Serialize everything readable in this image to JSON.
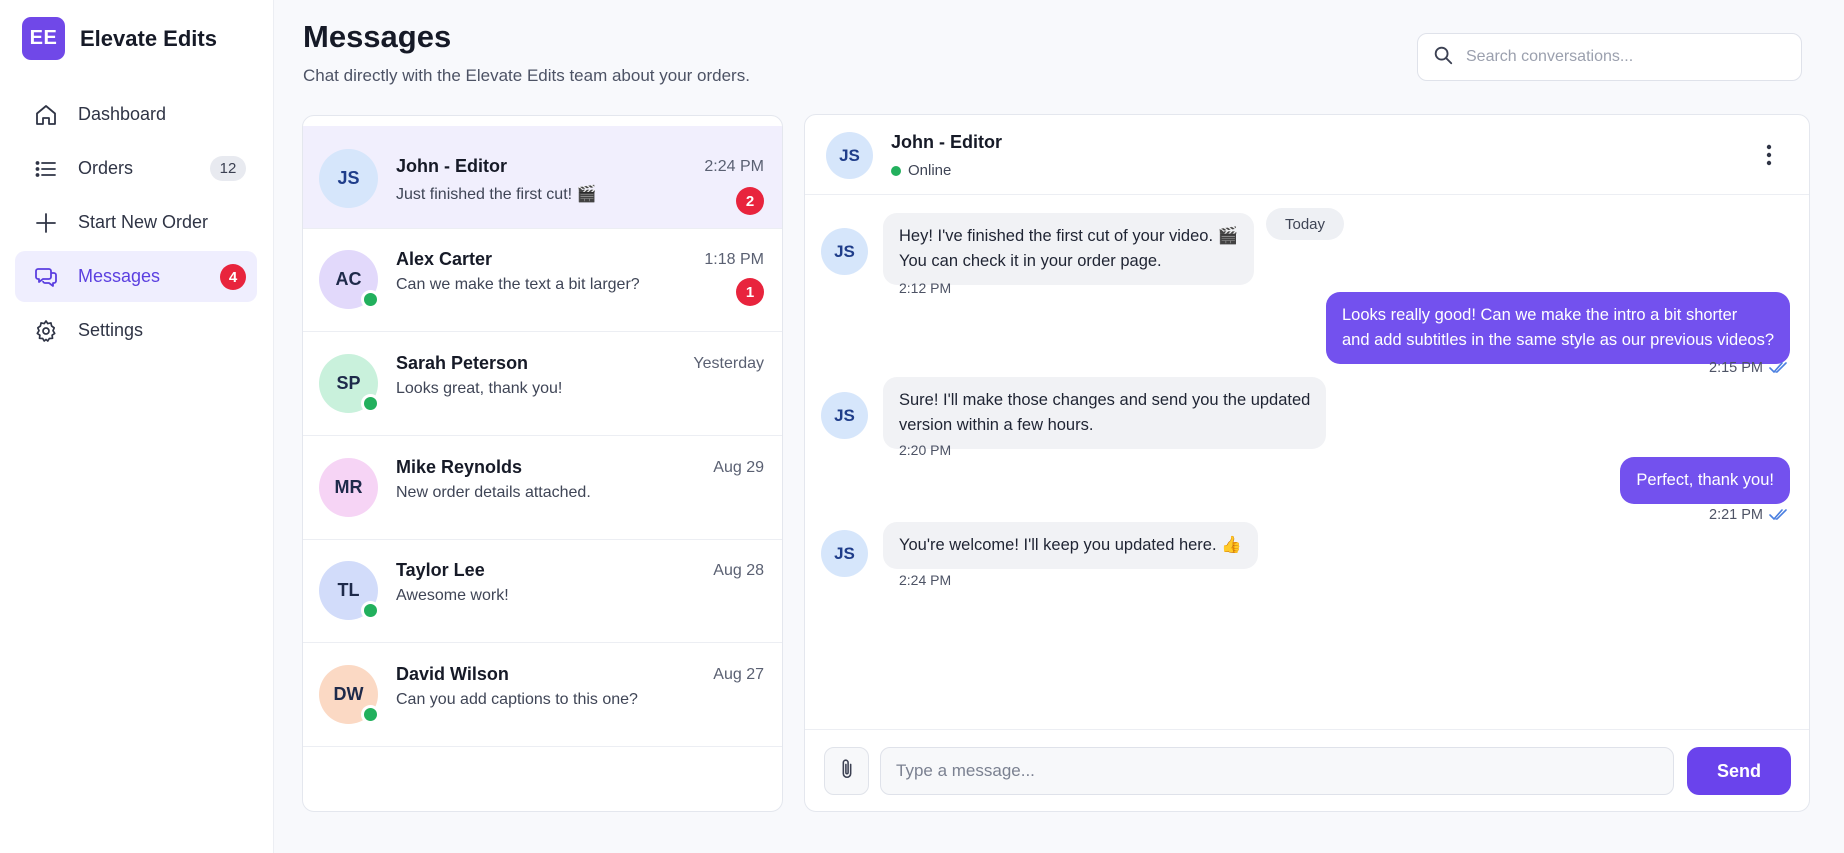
{
  "brand": {
    "logo_text": "EE",
    "name": "Elevate Edits",
    "accent": "#7048e8"
  },
  "nav": {
    "items": [
      {
        "label": "Dashboard",
        "icon": "home-icon"
      },
      {
        "label": "Orders",
        "icon": "list-icon",
        "count": "12"
      },
      {
        "label": "Start New Order",
        "icon": "plus-icon"
      },
      {
        "label": "Messages",
        "icon": "chat-icon",
        "badge": "4",
        "active": true
      },
      {
        "label": "Settings",
        "icon": "gear-icon"
      }
    ]
  },
  "header": {
    "title": "Messages",
    "subtitle": "Chat directly with the Elevate Edits team about your orders.",
    "search_placeholder": "Search conversations..."
  },
  "conversations": [
    {
      "initials": "JS",
      "name": "John - Editor",
      "time": "2:24 PM",
      "preview": "Just finished the first cut! 🎬",
      "unread": "2",
      "online": false,
      "active": true,
      "color": "#d6e6fb"
    },
    {
      "initials": "AC",
      "name": "Alex Carter",
      "time": "1:18 PM",
      "preview": "Can we make the text a bit larger?",
      "unread": "1",
      "online": true,
      "color": "#e2d9fb"
    },
    {
      "initials": "SP",
      "name": "Sarah Peterson",
      "time": "Yesterday",
      "preview": "Looks great, thank you!",
      "online": true,
      "color": "#c9f1dc"
    },
    {
      "initials": "MR",
      "name": "Mike Reynolds",
      "time": "Aug 29",
      "preview": "New order details attached.",
      "online": false,
      "color": "#f6d4f5"
    },
    {
      "initials": "TL",
      "name": "Taylor Lee",
      "time": "Aug 28",
      "preview": "Awesome work!",
      "online": true,
      "color": "#d2dcfa"
    },
    {
      "initials": "DW",
      "name": "David Wilson",
      "time": "Aug 27",
      "preview": "Can you add captions to this one?",
      "online": true,
      "color": "#fbd9c4"
    }
  ],
  "chat": {
    "contact_initials": "JS",
    "contact_name": "John - Editor",
    "status": "Online",
    "date_label": "Today",
    "messages": [
      {
        "from": "them",
        "lines": [
          "Hey! I've finished the first cut of your video. 🎬",
          "You can check it in your order page."
        ],
        "time": "2:12 PM"
      },
      {
        "from": "me",
        "lines": [
          "Looks really good! Can we make the intro a bit shorter",
          "and add subtitles in the same style as our previous videos?"
        ],
        "time": "2:15 PM"
      },
      {
        "from": "them",
        "lines": [
          "Sure! I'll make those changes and send you the updated",
          "version within a few hours."
        ],
        "time": "2:20 PM"
      },
      {
        "from": "me",
        "lines": [
          "Perfect, thank you!"
        ],
        "time": "2:21 PM"
      },
      {
        "from": "them",
        "lines": [
          "You're welcome! I'll keep you updated here. 👍"
        ],
        "time": "2:24 PM"
      }
    ],
    "input_placeholder": "Type a message...",
    "send_label": "Send"
  },
  "colors": {
    "unread_badge": "#e8243d",
    "online": "#22b05d",
    "outgoing_bubble": "#7351ee",
    "send_button": "#6a43ec"
  }
}
